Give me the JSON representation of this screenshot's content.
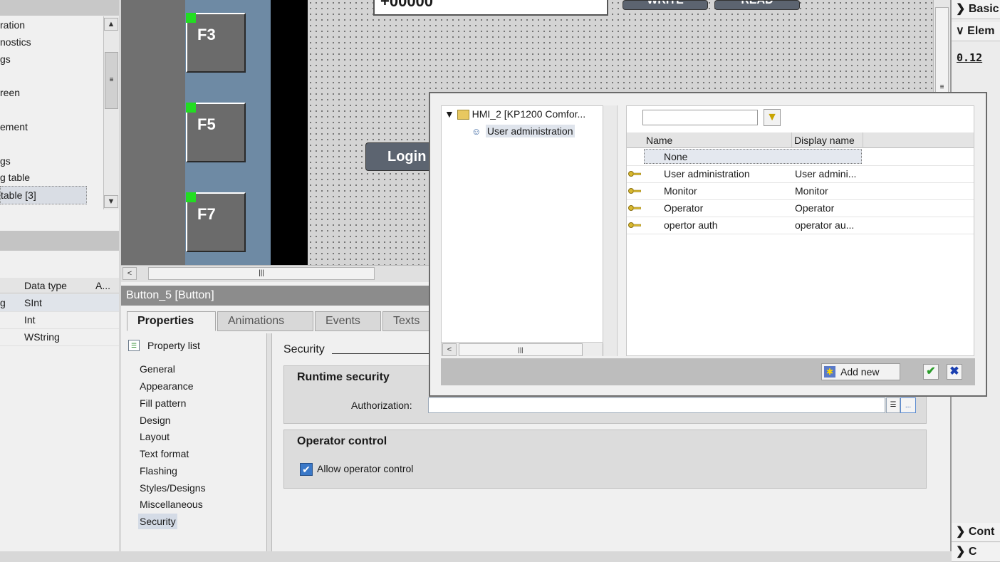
{
  "project_tree": {
    "items": [
      "ration",
      "nostics",
      "gs",
      "",
      "reen",
      "",
      "ement",
      "",
      "gs",
      "g table",
      "table [3]"
    ],
    "selected_index": 10
  },
  "tag_table": {
    "headers": [
      "Data type",
      "A..."
    ],
    "rows": [
      {
        "name": "g",
        "type": "SInt"
      },
      {
        "name": "",
        "type": "Int"
      },
      {
        "name": "",
        "type": "WString"
      }
    ]
  },
  "canvas": {
    "field_value": "+00000",
    "write_button": "WRITE",
    "read_button": "READ",
    "login_button": "Login",
    "fkeys": [
      "F3",
      "F5",
      "F7"
    ]
  },
  "inspector": {
    "title": "Button_5 [Button]",
    "tabs": [
      "Properties",
      "Animations",
      "Events",
      "Texts"
    ],
    "property_list_label": "Property list",
    "nav": [
      "General",
      "Appearance",
      "Fill pattern",
      "Design",
      "Layout",
      "Text format",
      "Flashing",
      "Styles/Designs",
      "Miscellaneous",
      "Security"
    ],
    "selected_nav": "Security",
    "section_title": "Security",
    "runtime_security": {
      "heading": "Runtime security",
      "authorization_label": "Authorization:",
      "authorization_value": ""
    },
    "operator_control": {
      "heading": "Operator control",
      "allow_label": "Allow operator control",
      "allow_checked": true
    }
  },
  "right_panel": {
    "items": [
      "Basic",
      "Elem",
      "Cont",
      "C"
    ],
    "display_label": "0.12"
  },
  "popup": {
    "tree": {
      "root": "HMI_2 [KP1200 Comfor...",
      "child": "User administration"
    },
    "filter_value": "",
    "columns": [
      "Name",
      "Display name"
    ],
    "rows": [
      {
        "name": "None",
        "display": "",
        "icon": ""
      },
      {
        "name": "User administration",
        "display": "User admini...",
        "icon": "key-icon"
      },
      {
        "name": "Monitor",
        "display": "Monitor",
        "icon": "key-icon"
      },
      {
        "name": "Operator",
        "display": "Operator",
        "icon": "key-icon"
      },
      {
        "name": "opertor auth",
        "display": "operator au...",
        "icon": "key-icon"
      }
    ],
    "add_new_label": "Add new",
    "ok_color": "#2a9d2a",
    "cancel_color": "#1a3fb0"
  }
}
